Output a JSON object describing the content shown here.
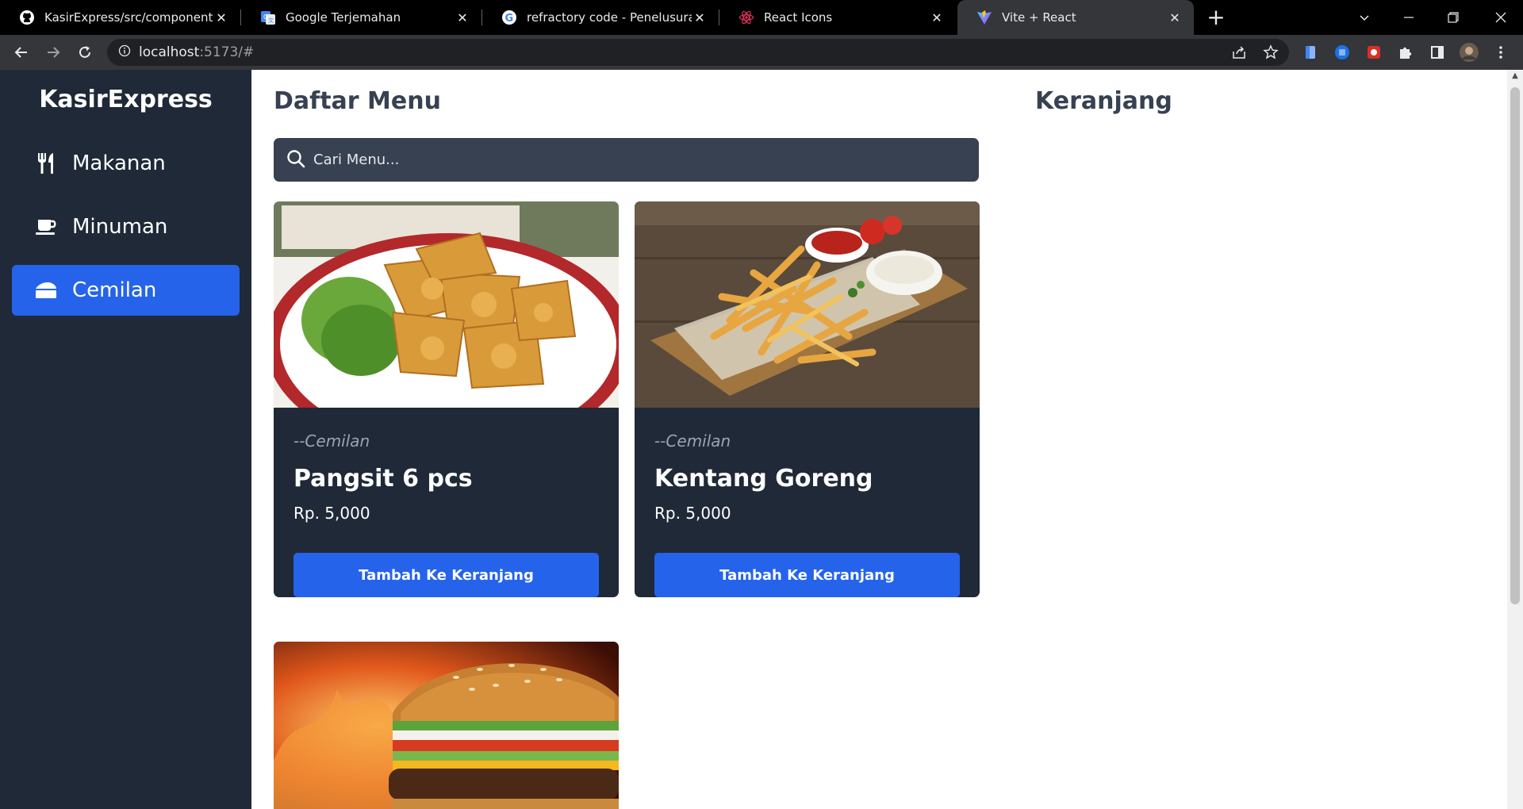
{
  "browser": {
    "tabs": [
      {
        "title": "KasirExpress/src/components/To",
        "icon": "github-icon",
        "active": false
      },
      {
        "title": "Google Terjemahan",
        "icon": "google-translate-icon",
        "active": false
      },
      {
        "title": "refractory code - Penelusuran Go",
        "icon": "google-icon",
        "active": false
      },
      {
        "title": "React Icons",
        "icon": "react-icon",
        "active": false
      },
      {
        "title": "Vite + React",
        "icon": "vite-icon",
        "active": true
      }
    ],
    "url_host": "localhost",
    "url_rest": ":5173/#"
  },
  "sidebar": {
    "brand": "KasirExpress",
    "items": [
      {
        "label": "Makanan",
        "icon": "utensils-icon",
        "active": false
      },
      {
        "label": "Minuman",
        "icon": "coffee-icon",
        "active": false
      },
      {
        "label": "Cemilan",
        "icon": "cheese-icon",
        "active": true
      }
    ]
  },
  "main": {
    "title": "Daftar Menu",
    "search_placeholder": "Cari Menu...",
    "products": [
      {
        "category": "--Cemilan",
        "name": "Pangsit 6 pcs",
        "price": "Rp. 5,000",
        "button": "Tambah Ke Keranjang"
      },
      {
        "category": "--Cemilan",
        "name": "Kentang Goreng",
        "price": "Rp. 5,000",
        "button": "Tambah Ke Keranjang"
      }
    ]
  },
  "cart": {
    "title": "Keranjang"
  },
  "colors": {
    "sidebar": "#1f2937",
    "accent": "#2563eb",
    "card": "#1f2937",
    "search": "#374151",
    "heading": "#374151"
  }
}
